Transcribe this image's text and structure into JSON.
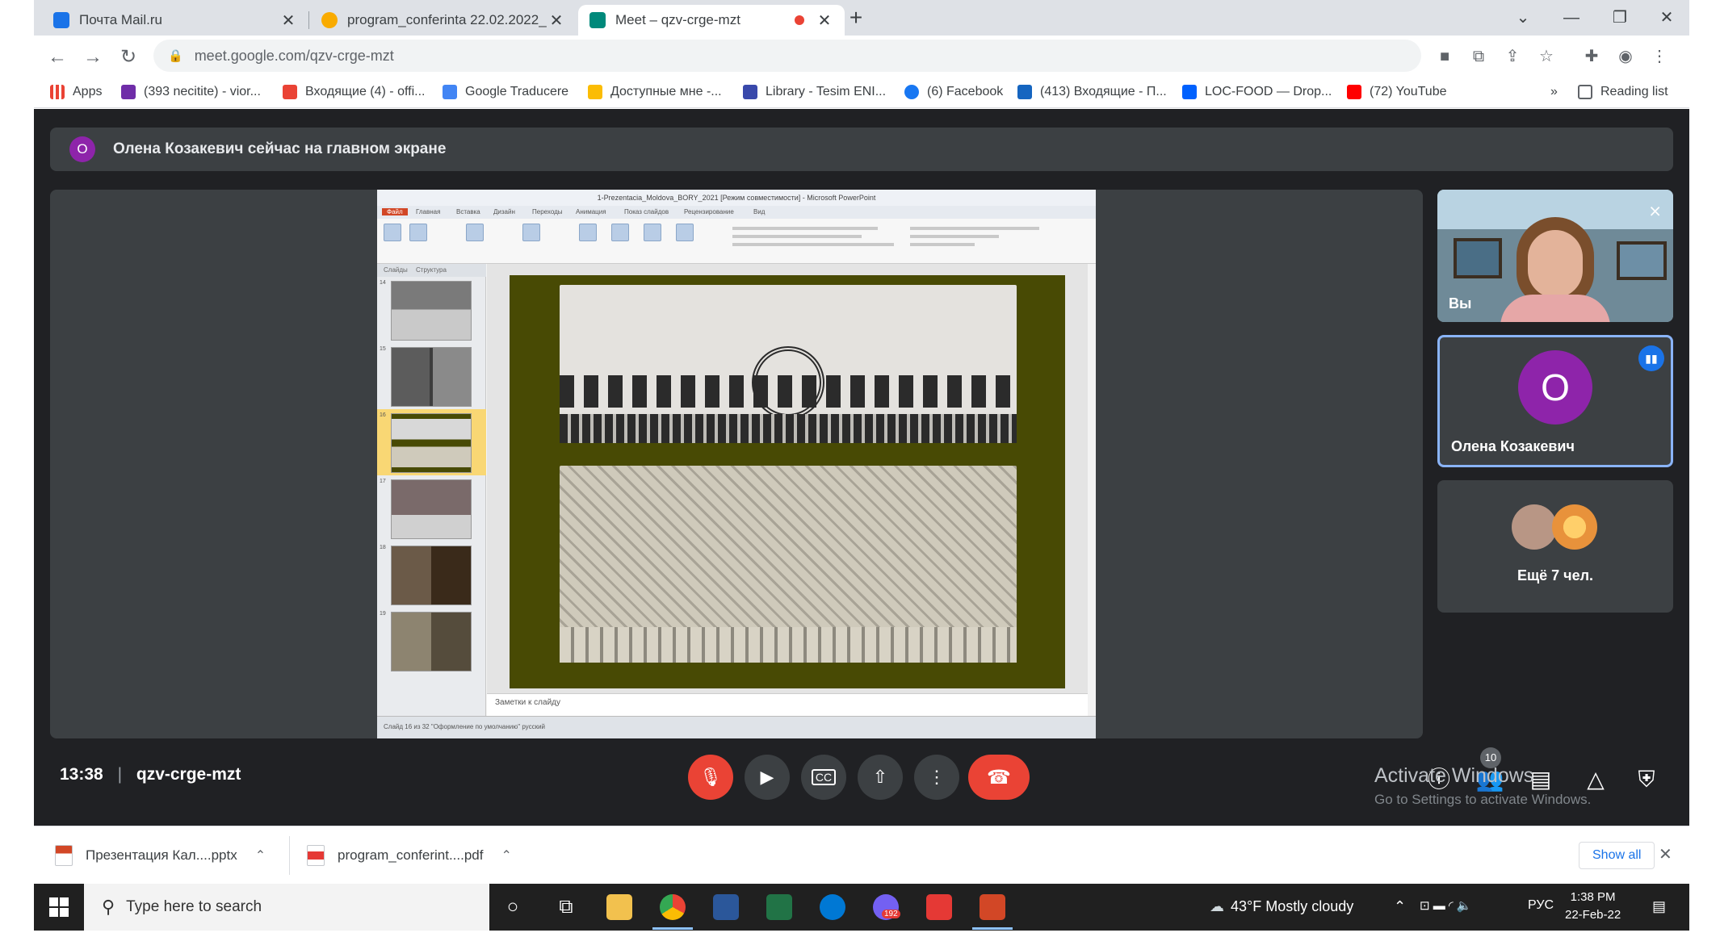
{
  "browser": {
    "tabs": [
      {
        "label": "Почта Mail.ru",
        "active": false,
        "favicon_color": "#1a73e8"
      },
      {
        "label": "program_conferinta 22.02.2022_",
        "active": false,
        "favicon_color": "#f9ab00"
      },
      {
        "label": "Meet – qzv-crge-mzt",
        "active": true,
        "favicon_color": "#00897b"
      }
    ],
    "new_tab_symbol": "+",
    "url": "meet.google.com/qzv-crge-mzt",
    "bookmarks": [
      {
        "label": "Apps",
        "icon_color": "#ea4335"
      },
      {
        "label": "(393 necitite) - vior...",
        "icon_color": "#6f2da8"
      },
      {
        "label": "Входящие (4) - offi...",
        "icon_color": "#ea4335"
      },
      {
        "label": "Google Traducere",
        "icon_color": "#4285f4"
      },
      {
        "label": "Доступные мне -...",
        "icon_color": "#fbbc04"
      },
      {
        "label": "Library - Tesim ENI...",
        "icon_color": "#3949ab"
      },
      {
        "label": "(6) Facebook",
        "icon_color": "#1877f2"
      },
      {
        "label": "(413) Входящие - П...",
        "icon_color": "#1565c0"
      },
      {
        "label": "LOC-FOOD — Drop...",
        "icon_color": "#0061fe"
      },
      {
        "label": "(72) YouTube",
        "icon_color": "#ff0000"
      }
    ],
    "bookmarks_overflow": "»",
    "reading_list": "Reading list"
  },
  "meet": {
    "banner": {
      "avatar_letter": "O",
      "text": "Олена Козакевич сейчас на главном экране"
    },
    "presentation": {
      "window_title": "1-Prezentacia_Moldova_BORY_2021 [Режим совместимости] - Microsoft PowerPoint",
      "ribbon_tabs": [
        "Файл",
        "Главная",
        "Вставка",
        "Дизайн",
        "Переходы",
        "Анимация",
        "Показ слайдов",
        "Рецензирование",
        "Вид"
      ],
      "panel_tabs": [
        "Слайды",
        "Структура"
      ],
      "thumbnails": [
        {
          "num": "14",
          "selected": false
        },
        {
          "num": "15",
          "selected": false
        },
        {
          "num": "16",
          "selected": true
        },
        {
          "num": "17",
          "selected": false
        },
        {
          "num": "18",
          "selected": false
        },
        {
          "num": "19",
          "selected": false
        }
      ],
      "notes_placeholder": "Заметки к слайду",
      "status_text": "Слайд 16 из 32   \"Оформление по умолчанию\"   русский"
    },
    "participants": {
      "self_label": "Вы",
      "featured": {
        "name": "Олена Козакевич",
        "letter": "O",
        "color": "#8e24aa"
      },
      "more_label": "Ещё 7 чел."
    },
    "time": "13:38",
    "separator": "|",
    "meeting_code": "qzv-crge-mzt",
    "participant_count": "10",
    "activate_title": "Activate Windows",
    "activate_subtitle": "Go to Settings to activate Windows."
  },
  "downloads": {
    "items": [
      {
        "label": "Презентация Кал....pptx",
        "icon_color": "#d24726"
      },
      {
        "label": "program_conferint....pdf",
        "icon_color": "#e53935"
      }
    ],
    "show_all": "Show all"
  },
  "taskbar": {
    "search_placeholder": "Type here to search",
    "weather": "43°F  Mostly cloudy",
    "language": "РУС",
    "time": "1:38 PM",
    "date": "22-Feb-22",
    "viber_badge": "192"
  }
}
